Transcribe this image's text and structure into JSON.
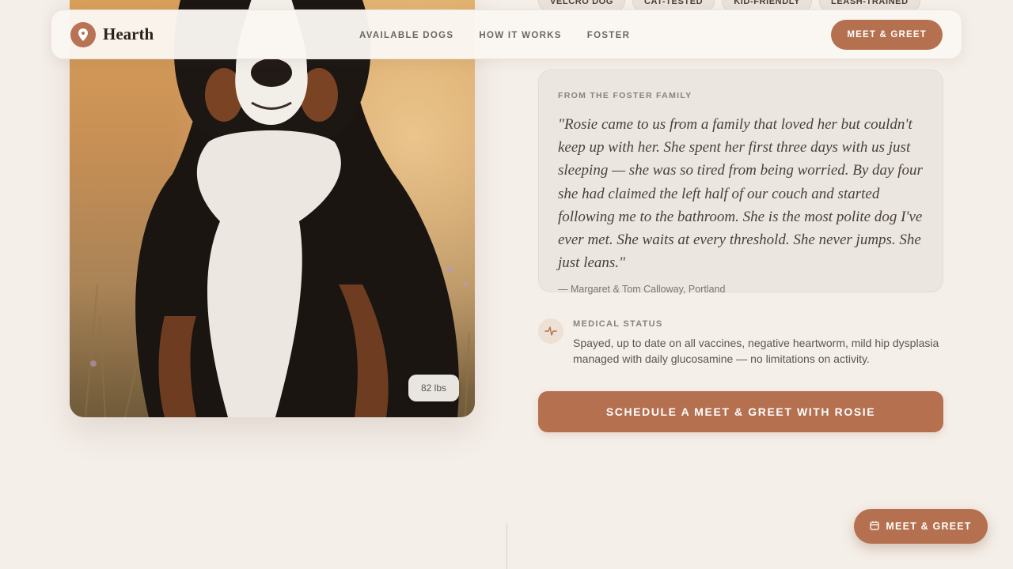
{
  "brand": {
    "name": "Hearth",
    "logo_icon": "map-pin-icon"
  },
  "nav": {
    "links": [
      "AVAILABLE DOGS",
      "HOW IT WORKS",
      "FOSTER"
    ],
    "cta": "MEET & GREET"
  },
  "tags": [
    "VELCRO DOG",
    "CAT-TESTED",
    "KID-FRIENDLY",
    "LEASH-TRAINED"
  ],
  "photo": {
    "weight": "82 lbs"
  },
  "testimonial": {
    "eyebrow": "FROM THE FOSTER FAMILY",
    "quote": "\"Rosie came to us from a family that loved her but couldn't keep up with her. She spent her first three days with us just sleeping — she was so tired from being worried. By day four she had claimed the left half of our couch and started following me to the bathroom. She is the most polite dog I've ever met. She waits at every threshold. She never jumps. She just leans.\"",
    "author": "— Margaret & Tom Calloway, Portland"
  },
  "medical": {
    "icon": "heartbeat-icon",
    "title": "MEDICAL STATUS",
    "text": "Spayed, up to date on all vaccines, negative heartworm, mild hip dysplasia managed with daily glucosamine — no limitations on activity."
  },
  "schedule_button": "SCHEDULE A MEET & GREET WITH ROSIE",
  "floating_cta": {
    "label": "MEET & GREET",
    "icon": "calendar-icon"
  },
  "colors": {
    "accent": "#b5704f",
    "background": "#f5efe9",
    "card": "#ebe6e0"
  }
}
